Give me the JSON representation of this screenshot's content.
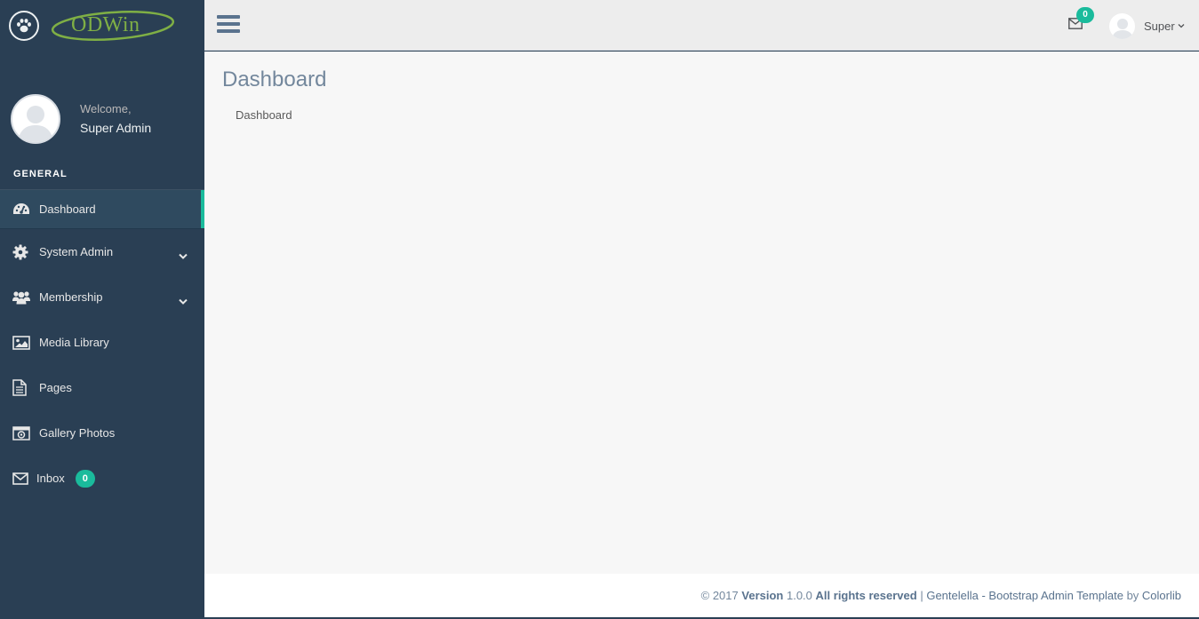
{
  "brand": {
    "logo_text": "ODWin",
    "icon": "paw-icon"
  },
  "profile": {
    "welcome": "Welcome,",
    "name": "Super Admin"
  },
  "sidebar": {
    "section_title": "GENERAL",
    "items": [
      {
        "label": "Dashboard",
        "icon": "dashboard-icon",
        "active": true
      },
      {
        "label": "System Admin",
        "icon": "gear-icon",
        "has_submenu": true
      },
      {
        "label": "Membership",
        "icon": "users-icon",
        "has_submenu": true
      },
      {
        "label": "Media Library",
        "icon": "image-icon"
      },
      {
        "label": "Pages",
        "icon": "document-icon"
      },
      {
        "label": "Gallery Photos",
        "icon": "camera-icon"
      },
      {
        "label": "Inbox",
        "icon": "envelope-icon",
        "badge": "0"
      }
    ]
  },
  "topnav": {
    "mail_badge": "0",
    "user_name": "Super"
  },
  "page": {
    "title": "Dashboard",
    "breadcrumb": "Dashboard"
  },
  "footer": {
    "copyright": "© 2017",
    "version_label": "Version",
    "version": "1.0.0",
    "rights": "All rights reserved",
    "separator": "|",
    "template_text": "Gentelella - Bootstrap Admin Template",
    "by": "by",
    "author": "Colorlib"
  },
  "colors": {
    "sidebar_bg": "#2A3F54",
    "accent": "#1ABB9C",
    "topnav_bg": "#EDEDED",
    "content_bg": "#F7F7F7",
    "logo_green": "#7FAF45"
  }
}
